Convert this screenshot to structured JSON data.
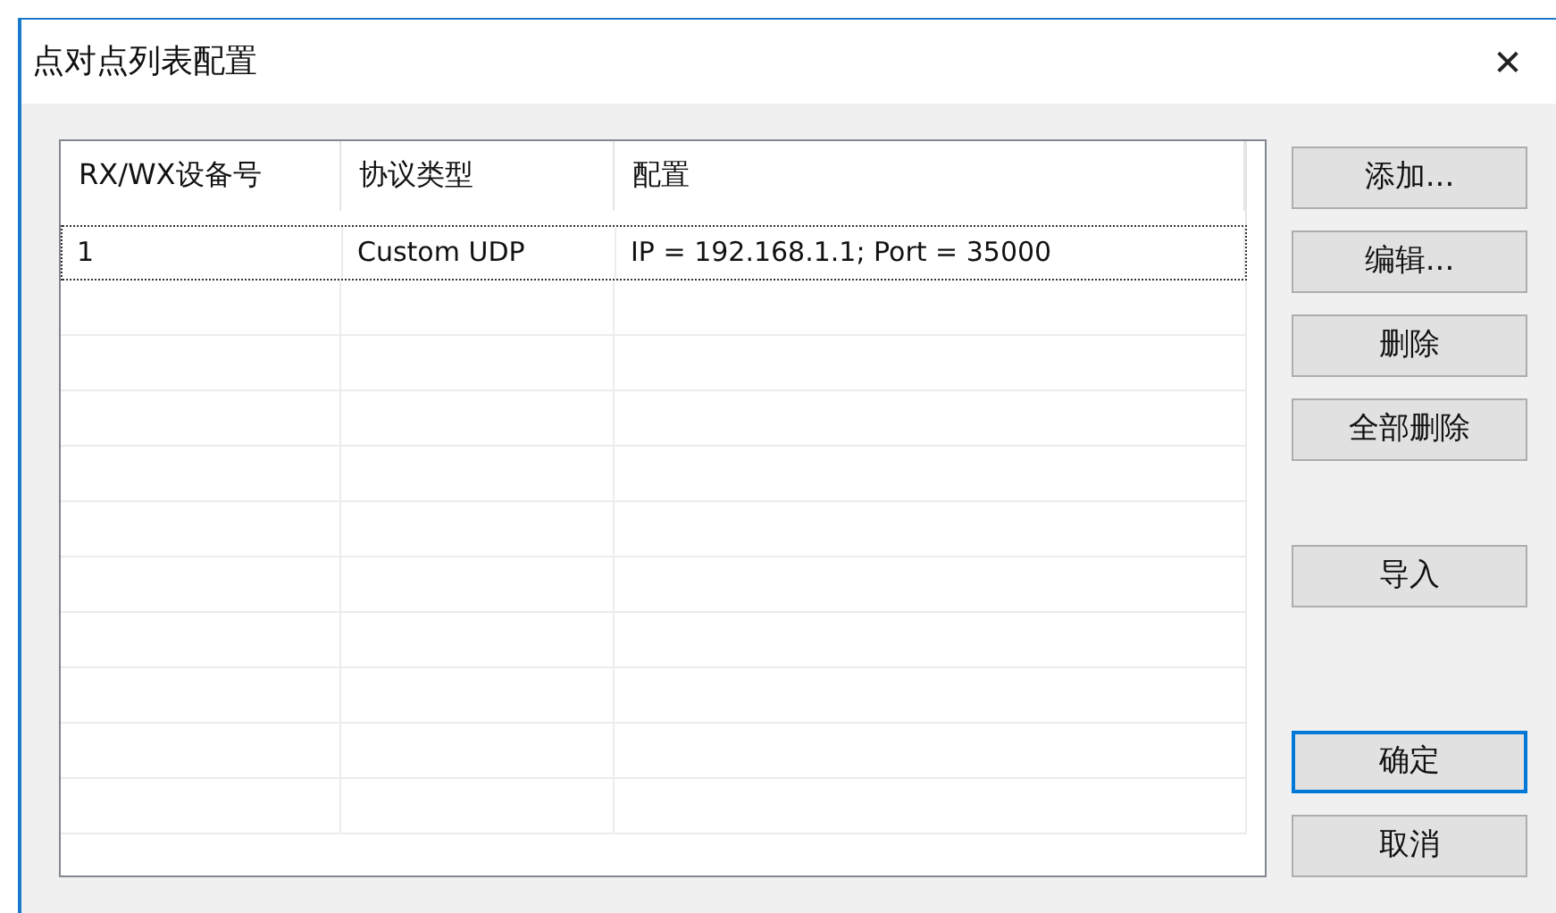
{
  "window": {
    "title": "点对点列表配置",
    "close": "✕"
  },
  "table": {
    "columns": [
      "RX/WX设备号",
      "协议类型",
      "配置"
    ],
    "rows": [
      {
        "cells": [
          "1",
          "Custom UDP",
          "IP = 192.168.1.1; Port = 35000"
        ],
        "focused": true
      }
    ]
  },
  "button_groups": [
    [
      {
        "label": "添加...",
        "default": false
      },
      {
        "label": "编辑...",
        "default": false
      },
      {
        "label": "删除",
        "default": false
      },
      {
        "label": "全部删除",
        "default": false
      }
    ],
    [
      {
        "label": "导入",
        "default": false
      }
    ],
    [
      {
        "label": "确定",
        "default": true
      },
      {
        "label": "取消",
        "default": false
      }
    ]
  ]
}
